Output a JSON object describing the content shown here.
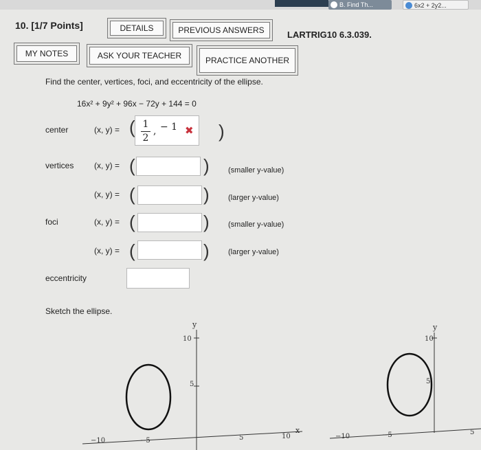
{
  "browser": {
    "tabs": [
      {
        "label": "B. Find Th..."
      },
      {
        "label": "6x2 + 2y2..."
      }
    ]
  },
  "question": {
    "number_label": "10.",
    "points_label": "[1/7 Points]",
    "code": "LARTRIG10 6.3.039."
  },
  "buttons": {
    "details": "DETAILS",
    "previous_answers": "PREVIOUS ANSWERS",
    "my_notes": "MY NOTES",
    "ask_teacher": "ASK YOUR TEACHER",
    "practice_another": "PRACTICE ANOTHER"
  },
  "problem": {
    "prompt": "Find the center, vertices, foci, and eccentricity of the ellipse.",
    "equation": "16x² + 9y² + 96x − 72y + 144 = 0"
  },
  "center": {
    "label": "center",
    "xy_label": "(x, y) =",
    "answer_x_num": "1",
    "answer_x_den": "2",
    "answer_sep": ",",
    "answer_y": "− 1",
    "status": "✖"
  },
  "vertices": {
    "label": "vertices",
    "rows": [
      {
        "xy_label": "(x, y) =",
        "value": "",
        "note": "(smaller y-value)"
      },
      {
        "xy_label": "(x, y) =",
        "value": "",
        "note": "(larger y-value)"
      }
    ]
  },
  "foci": {
    "label": "foci",
    "rows": [
      {
        "xy_label": "(x, y) =",
        "value": "",
        "note": "(smaller y-value)"
      },
      {
        "xy_label": "(x, y) =",
        "value": "",
        "note": "(larger y-value)"
      }
    ]
  },
  "eccentricity": {
    "label": "eccentricity",
    "value": ""
  },
  "sketch": {
    "prompt": "Sketch the ellipse."
  },
  "graphs": [
    {
      "y_axis_label": "y",
      "x_axis_label": "x",
      "y_ticks": [
        "10",
        "5"
      ],
      "x_ticks": [
        "−10",
        "−5",
        "5",
        "10"
      ]
    },
    {
      "y_axis_label": "y",
      "y_ticks": [
        "10",
        "5"
      ],
      "x_ticks": [
        "−10",
        "−5",
        "5"
      ]
    }
  ],
  "colors": {
    "wrong": "#c8323c",
    "border": "#777777",
    "tab_active": "#7d8b99"
  }
}
